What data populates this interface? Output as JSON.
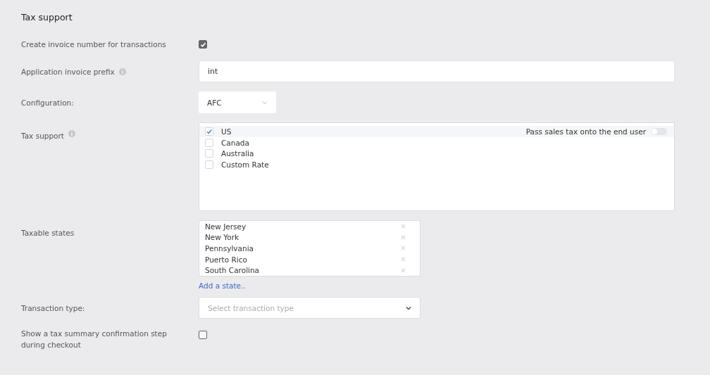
{
  "title": "Tax support",
  "fields": [
    {
      "kind": "checkbox",
      "label": "Create invoice number for transactions",
      "checked": true
    },
    {
      "kind": "text",
      "label": "Application invoice prefix",
      "info": true,
      "value": "int"
    },
    {
      "kind": "select",
      "label": "Configuration:",
      "wide": false,
      "value": "AFC"
    },
    {
      "kind": "checklist",
      "label": "Tax support",
      "info": true,
      "options": [
        {
          "label": "US",
          "checked": true,
          "toggle": {
            "label": "Pass sales tax onto the end user",
            "on": false
          }
        },
        {
          "label": "Canada",
          "checked": false
        },
        {
          "label": "Australia",
          "checked": false
        },
        {
          "label": "Custom Rate",
          "checked": false
        }
      ]
    },
    {
      "kind": "tags",
      "label": "Taxable states",
      "tags": [
        "New Jersey",
        "New York",
        "Pennsylvania",
        "Puerto Rico",
        "South Carolina"
      ],
      "link": "Add a state.."
    },
    {
      "kind": "select",
      "label": "Transaction type:",
      "wide": true,
      "placeholder": "Select transaction type"
    },
    {
      "kind": "checkbox",
      "label": "Show a tax summary confirmation step during checkout",
      "checked": false
    }
  ]
}
